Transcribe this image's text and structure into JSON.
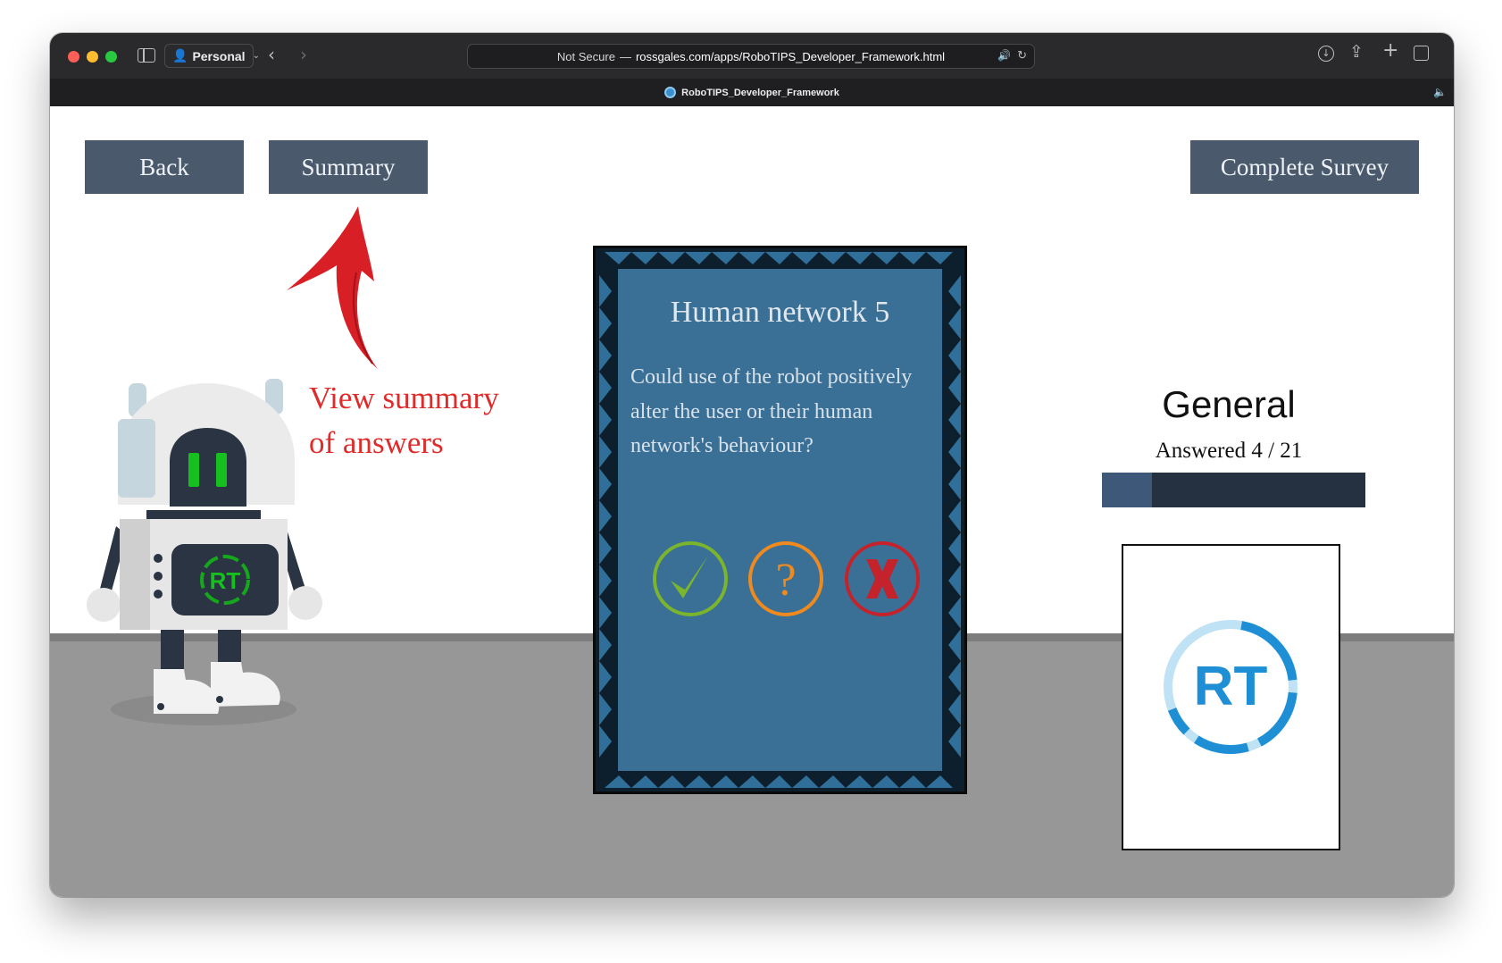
{
  "browser": {
    "profile": "Personal",
    "url_prefix": "Not Secure",
    "url_separator": "—",
    "url": "rossgales.com/apps/RoboTIPS_Developer_Framework.html",
    "tab_title": "RoboTIPS_Developer_Framework"
  },
  "toolbar": {
    "back_label": "Back",
    "summary_label": "Summary",
    "complete_label": "Complete Survey"
  },
  "hint": {
    "line1": "View summary",
    "line2": "of answers",
    "color": "#e02b2b"
  },
  "robot": {
    "chest_badge": "RT"
  },
  "card": {
    "title": "Human network 5",
    "question": "Could use of the robot positively alter the user or their human network's behaviour?",
    "answers": [
      {
        "name": "yes",
        "icon": "check-icon",
        "color": "#7ab52d"
      },
      {
        "name": "unsure",
        "icon": "question-icon",
        "color": "#ee8a1f",
        "glyph": "?"
      },
      {
        "name": "no",
        "icon": "cross-icon",
        "color": "#c4232b"
      }
    ]
  },
  "category": {
    "title": "General",
    "answered_label": "Answered",
    "answered": 4,
    "total": 21,
    "answered_text": "4 / 21",
    "progress_fraction": 0.19
  },
  "logo": {
    "text": "RT",
    "color": "#1e8fd5"
  }
}
